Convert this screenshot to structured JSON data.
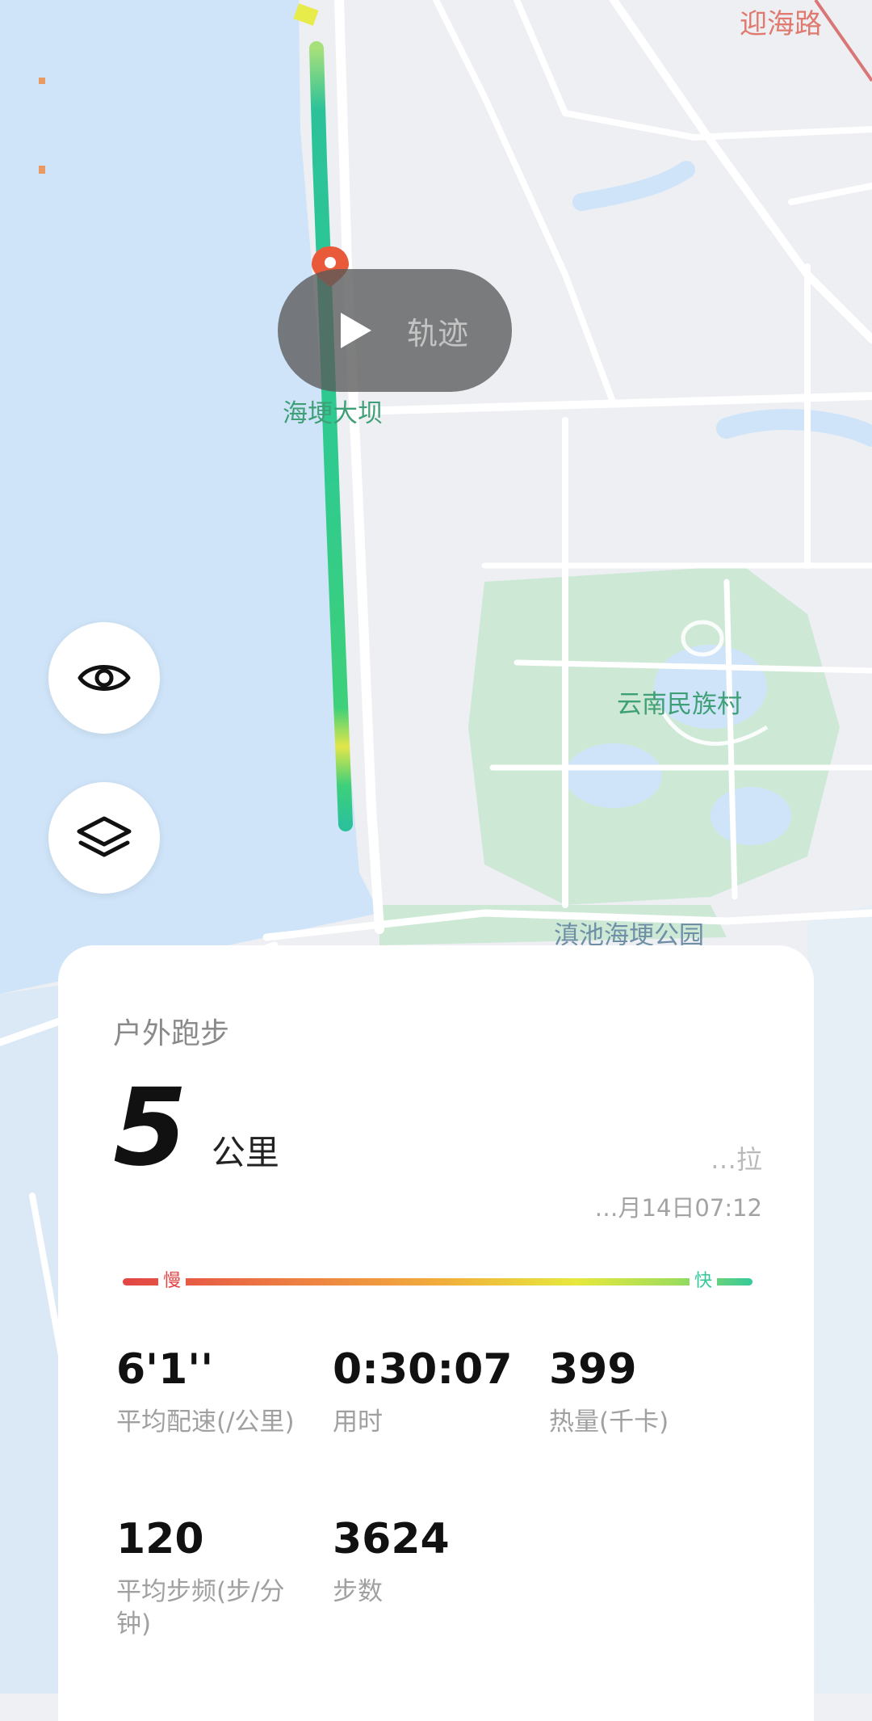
{
  "map": {
    "labels": {
      "dam": "海埂大坝",
      "village": "云南民族村",
      "park": "滇池海埂公园",
      "road": "迎海路"
    },
    "colors": {
      "water": "#cfe4f8",
      "land": "#edeff3",
      "park": "#cde9d6",
      "road": "#ffffff",
      "track_start": "#2bc29a",
      "track_end": "#3ed07a"
    }
  },
  "replay": {
    "label": "轨迹",
    "icon": "play-icon"
  },
  "controls": {
    "visibility_icon": "eye-icon",
    "layers_icon": "layers-icon"
  },
  "summary": {
    "activity": "户外跑步",
    "distance": "5",
    "distance_unit": "公里",
    "user": "…拉",
    "date": "…月14日07:12",
    "pace_scale": {
      "slow": "慢",
      "fast": "快"
    }
  },
  "stats": {
    "pace_value": "6'1''",
    "pace_label": "平均配速(/公里)",
    "time_value": "0:30:07",
    "time_label": "用时",
    "calories_value": "399",
    "calories_label": "热量(千卡)",
    "cadence_value": "120",
    "cadence_label": "平均步频(步/分钟)",
    "steps_value": "3624",
    "steps_label": "步数"
  }
}
